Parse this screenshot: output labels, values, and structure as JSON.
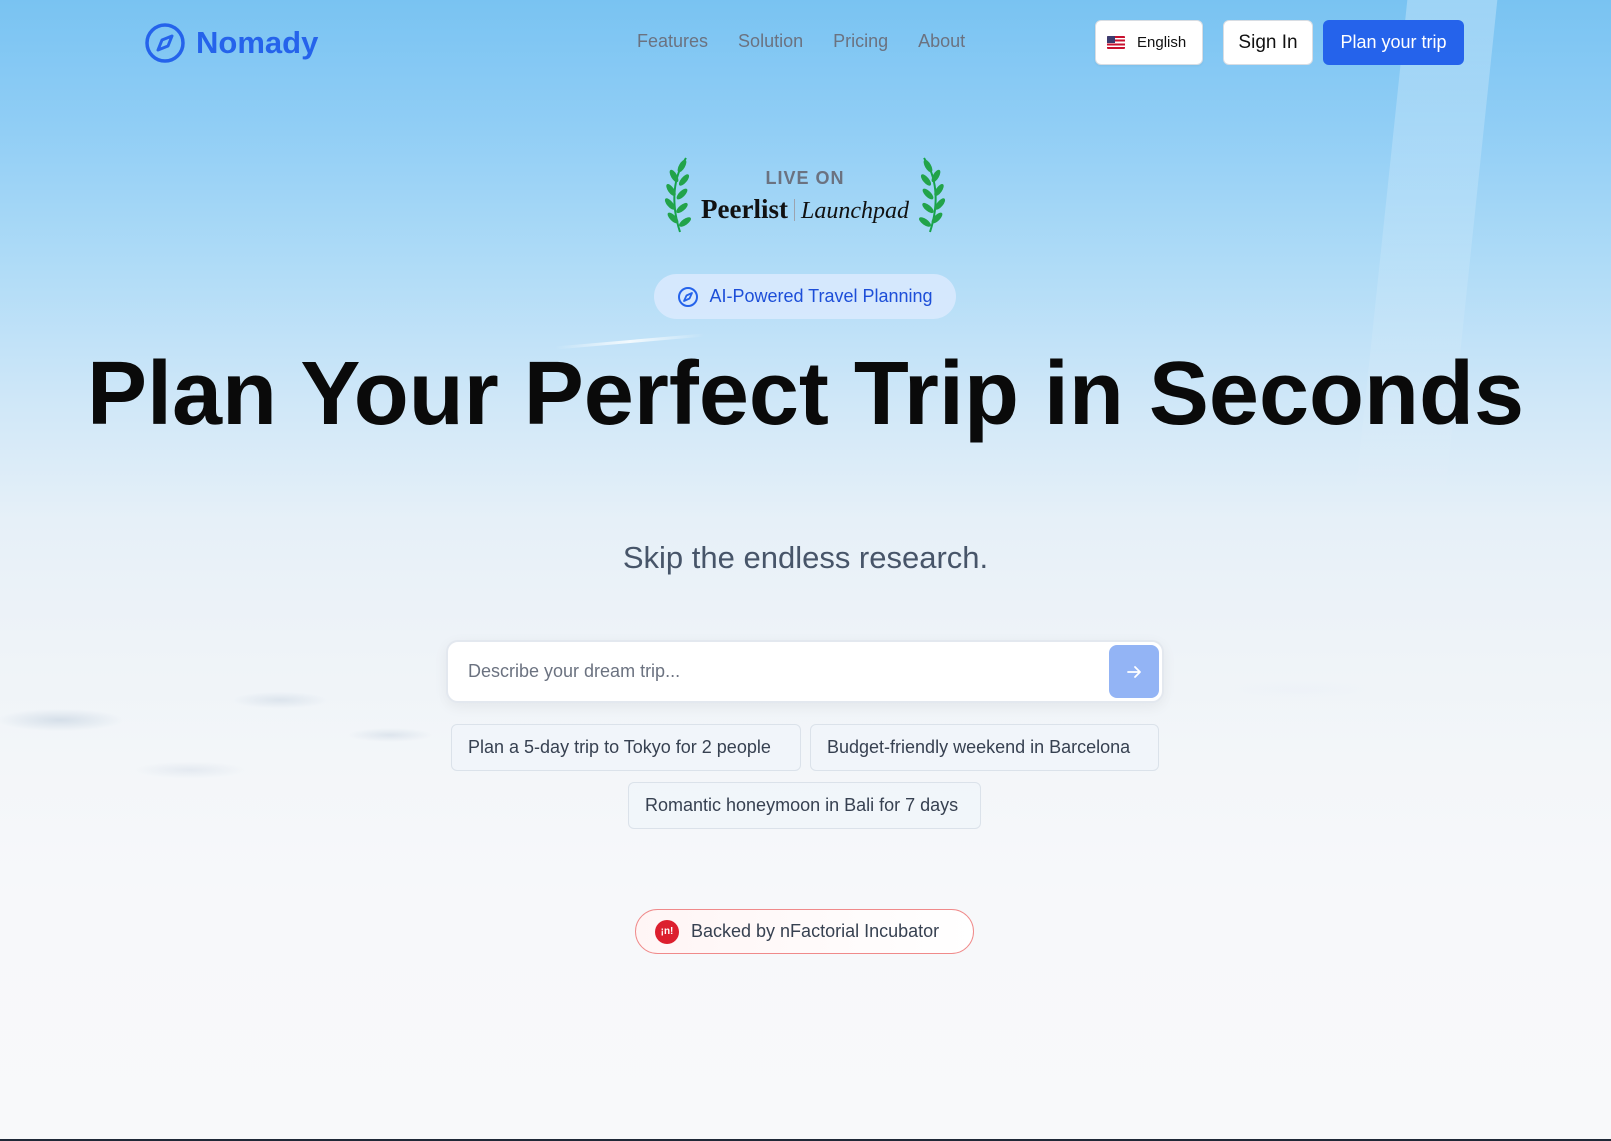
{
  "brand": {
    "name": "Nomady",
    "logo_icon": "compass-icon",
    "color": "#2563eb"
  },
  "nav": {
    "items": [
      {
        "label": "Features"
      },
      {
        "label": "Solution"
      },
      {
        "label": "Pricing"
      },
      {
        "label": "About"
      }
    ]
  },
  "header": {
    "language": {
      "label": "English",
      "flag_icon": "us-flag-icon"
    },
    "signin_label": "Sign In",
    "cta_label": "Plan your trip"
  },
  "peerlist": {
    "top": "LIVE ON",
    "name": "Peerlist",
    "sub": "Launchpad"
  },
  "hero": {
    "pill_label": "AI-Powered Travel Planning",
    "title": "Plan Your Perfect Trip in Seconds",
    "subtitle": "Skip the endless research."
  },
  "search": {
    "placeholder": "Describe your dream trip...",
    "value": "",
    "submit_icon": "arrow-right-icon"
  },
  "suggestions": [
    {
      "label": "Plan a 5-day trip to Tokyo for 2 people"
    },
    {
      "label": "Budget-friendly weekend in Barcelona"
    },
    {
      "label": "Romantic honeymoon in Bali for 7 days"
    }
  ],
  "backed": {
    "logo_text": "¡n!",
    "label": "Backed by nFactorial Incubator",
    "accent": "#dc1f2e"
  }
}
